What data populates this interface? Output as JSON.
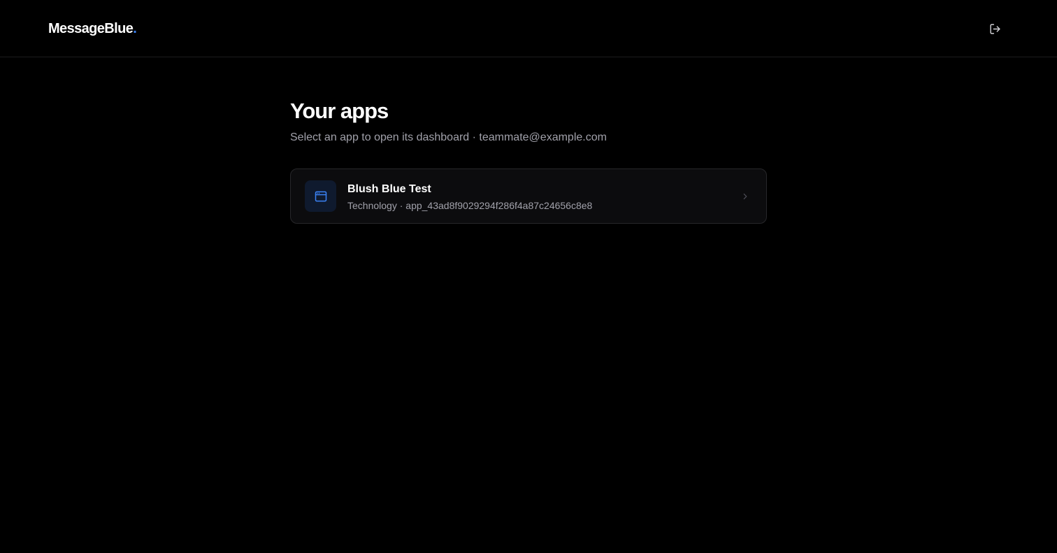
{
  "header": {
    "brand_text": "MessageBlue",
    "brand_dot": ".",
    "logout_icon": "logout-icon"
  },
  "main": {
    "title": "Your apps",
    "subtitle_prefix": "Select an app to open its dashboard",
    "separator": " · ",
    "user_email": "teammate@example.com"
  },
  "apps": [
    {
      "name": "Blush Blue Test",
      "category": "Technology",
      "separator": " · ",
      "app_id": "app_43ad8f9029294f286f4a87c24656c8e8",
      "icon": "browser-window-icon"
    }
  ],
  "colors": {
    "background": "#000000",
    "accent": "#3b82f6",
    "card_background": "#0c0c0e",
    "card_border": "#27272a",
    "muted_text": "#a1a1aa"
  }
}
